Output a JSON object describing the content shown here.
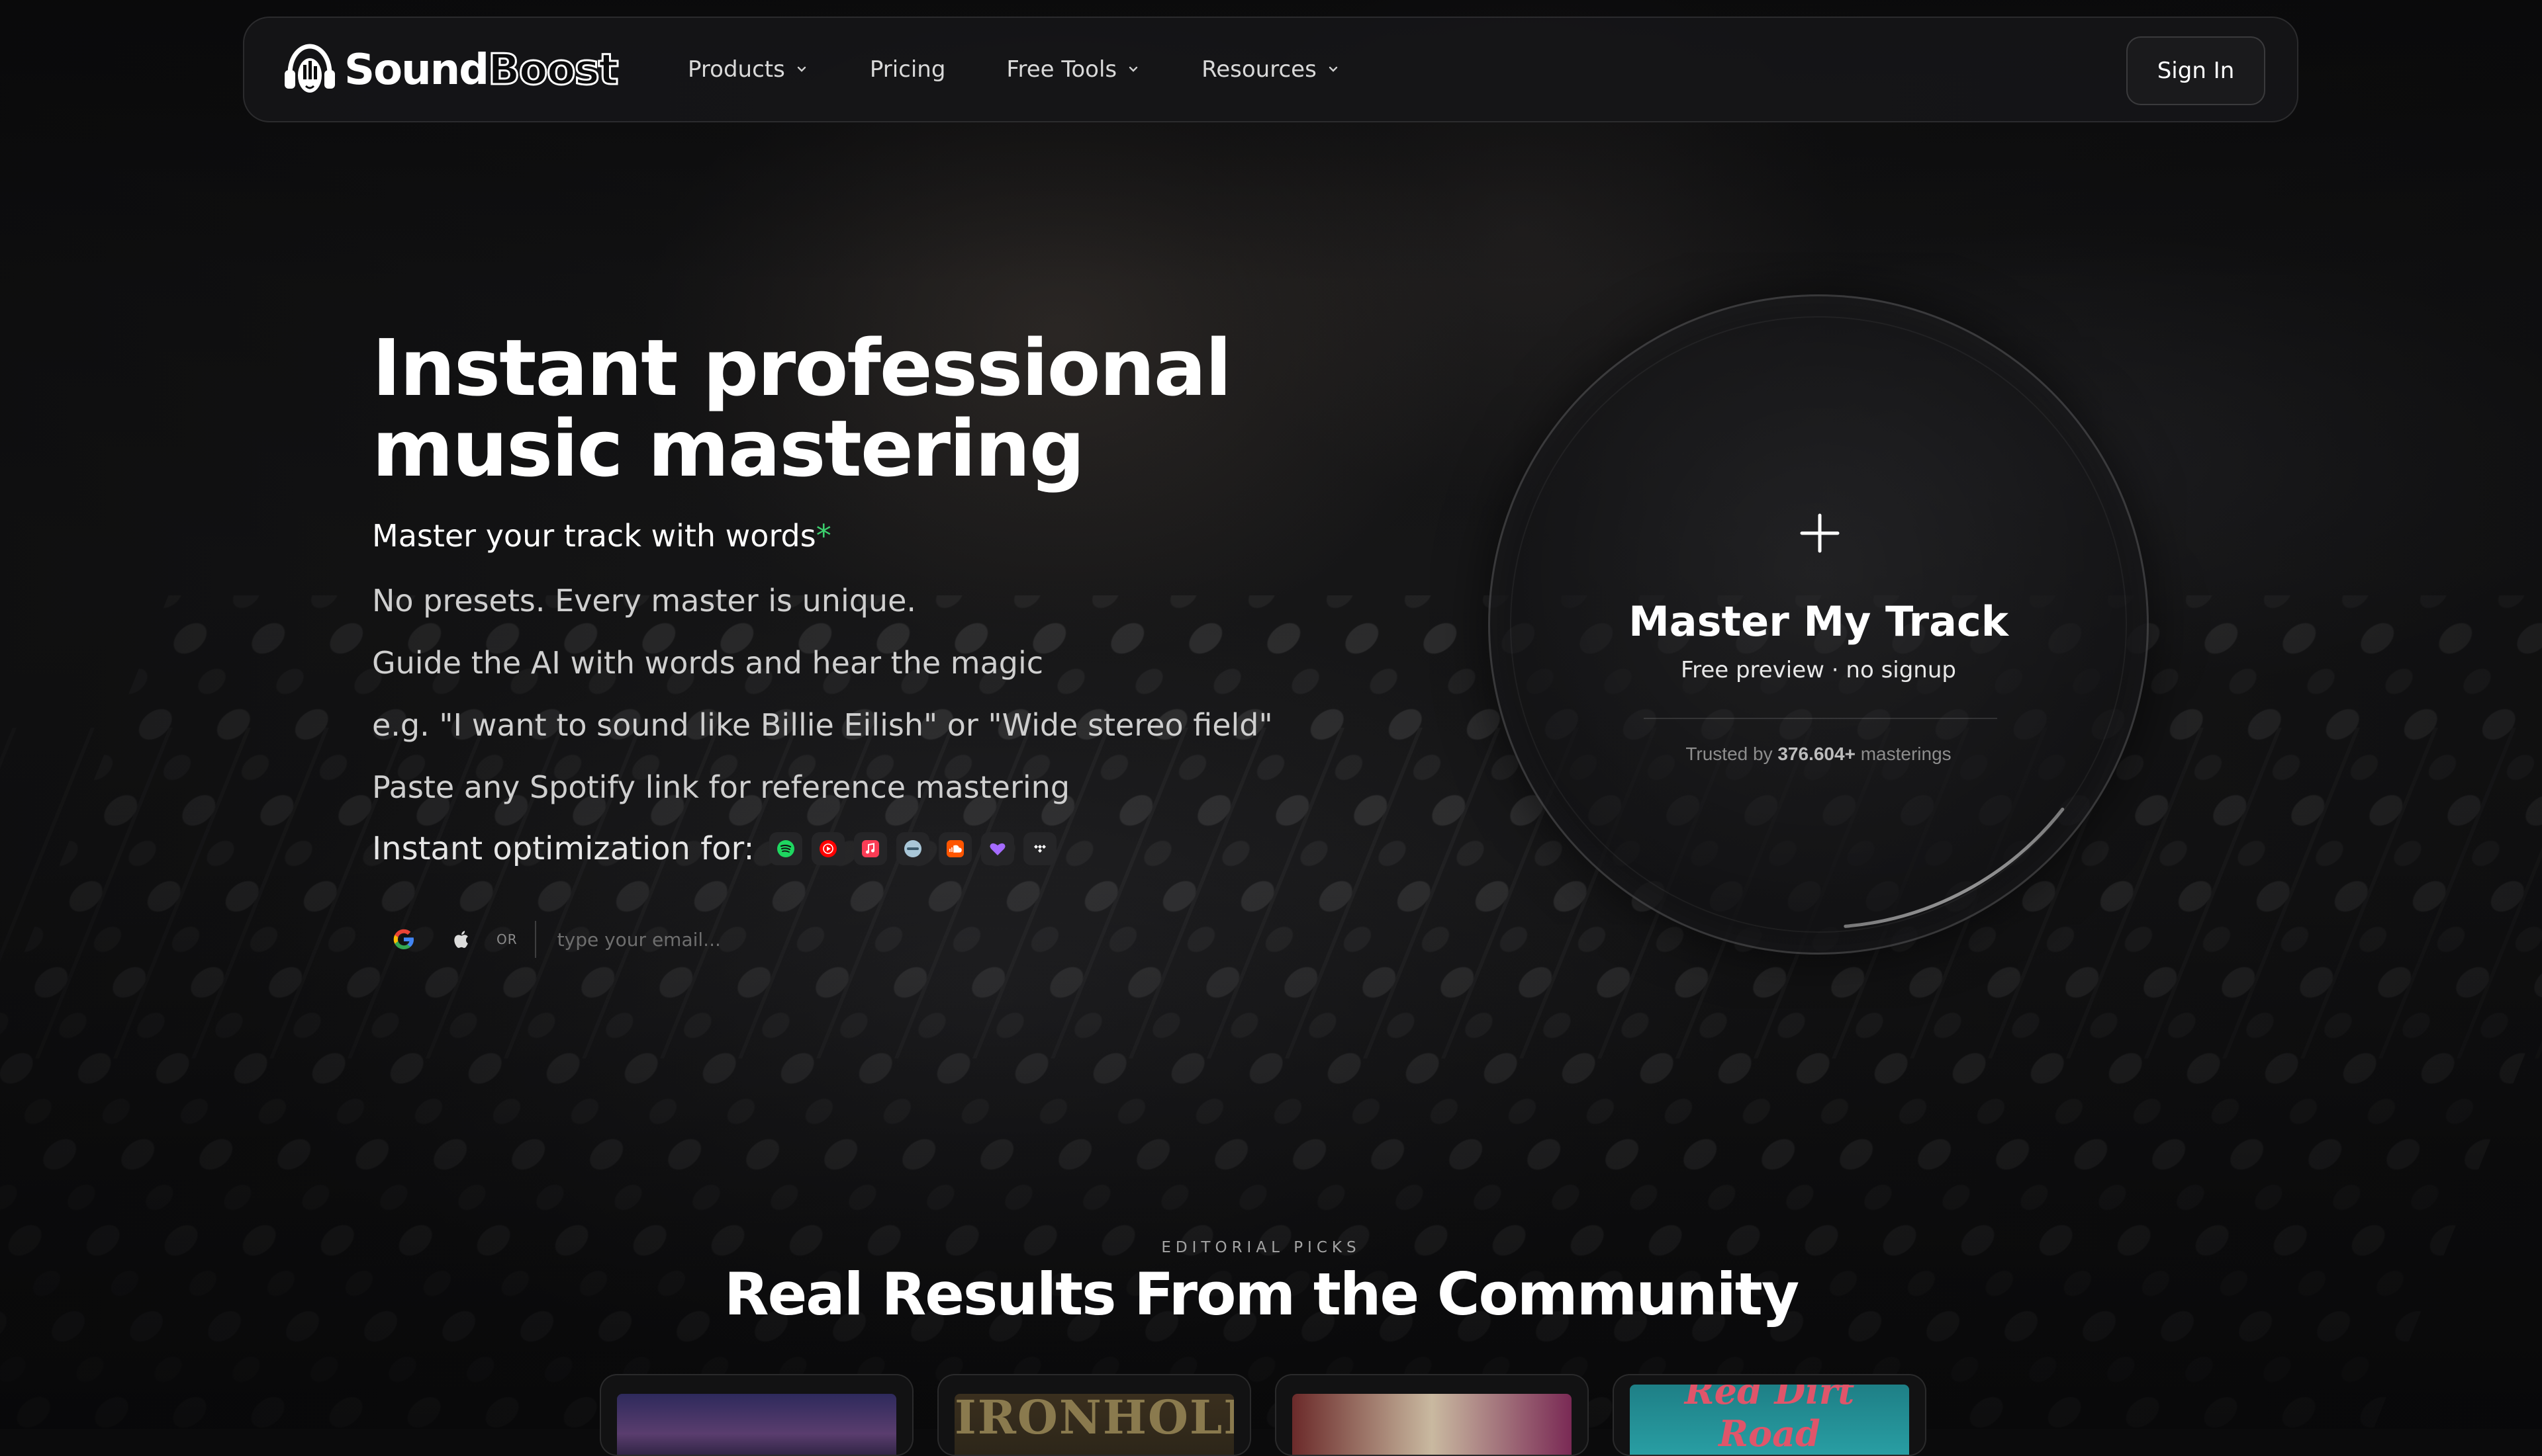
{
  "brand": {
    "name_solid": "Sound",
    "name_outline": "Boost"
  },
  "nav": {
    "items": [
      {
        "label": "Products",
        "dropdown": true
      },
      {
        "label": "Pricing",
        "dropdown": false
      },
      {
        "label": "Free Tools",
        "dropdown": true
      },
      {
        "label": "Resources",
        "dropdown": true
      }
    ],
    "sign_in": "Sign In"
  },
  "hero": {
    "title_line1": "Instant professional",
    "title_line2": "music mastering",
    "subtitle": "Master your track with words",
    "subtitle_mark": "*",
    "lines": [
      "No presets. Every master is unique.",
      "Guide the AI with words and hear the magic",
      "e.g. \"I want to sound like Billie Eilish\" or \"Wide stereo field\"",
      "Paste any Spotify link for reference mastering"
    ],
    "optimization_label": "Instant optimization for:",
    "platform_icons": [
      "spotify-icon",
      "youtube-icon",
      "apple-music-icon",
      "deezer-icon",
      "soundcloud-icon",
      "heart-icon",
      "tidal-icon"
    ]
  },
  "auth": {
    "or_label": "OR",
    "email_placeholder": "type your email..."
  },
  "upload": {
    "title": "Master My Track",
    "caption": "Free preview · no signup",
    "trusted_prefix": "Trusted by",
    "trusted_count": "376.604+",
    "trusted_suffix": "masterings"
  },
  "community": {
    "eyebrow": "EDITORIAL PICKS",
    "title": "Real Results From the Community",
    "cards": [
      {
        "art_text": ""
      },
      {
        "art_text": "IRONHOLD"
      },
      {
        "art_text": ""
      },
      {
        "art_text": "Red Dirt Road"
      }
    ]
  },
  "colors": {
    "background": "#0b0b0c",
    "accent_asterisk": "#3ccf6e",
    "nav_text": "#d9d9d9",
    "muted_text": "#8d8d8d"
  }
}
